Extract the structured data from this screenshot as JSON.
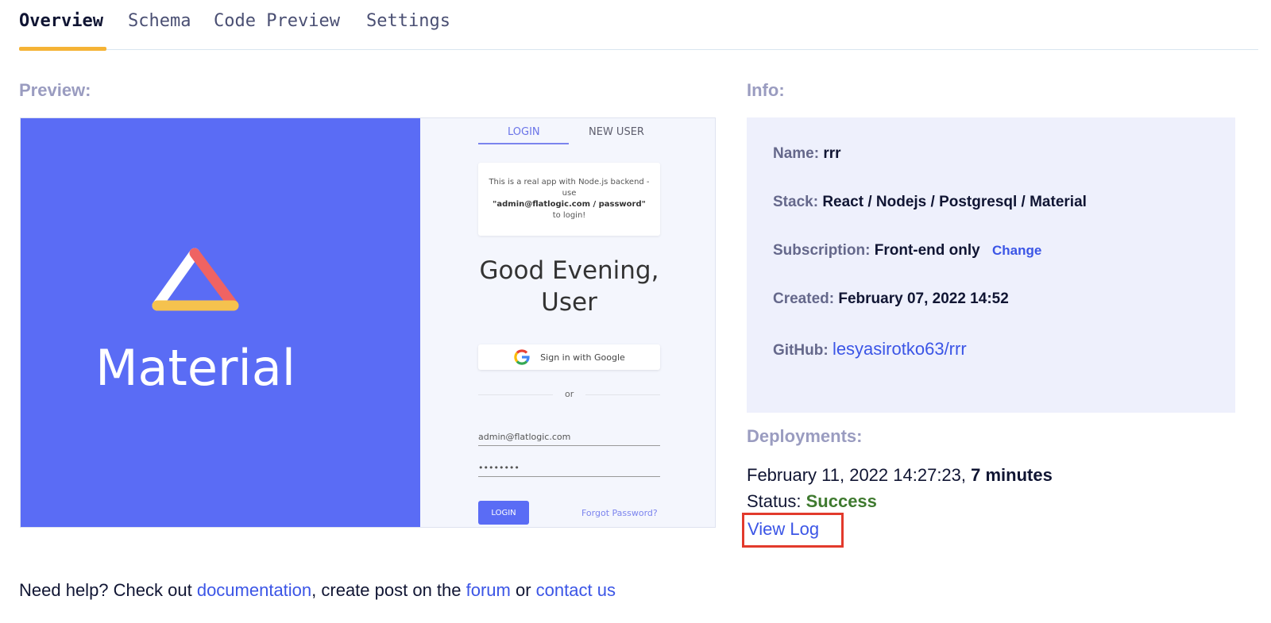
{
  "tabs": [
    "Overview",
    "Schema",
    "Code Preview",
    "Settings"
  ],
  "preview": {
    "title": "Preview:",
    "brand": "Material",
    "login_tab": "LOGIN",
    "new_user_tab": "NEW USER",
    "notice_line1": "This is a real app with Node.js backend -",
    "notice_line2": "use",
    "notice_creds": "\"admin@flatlogic.com / password\"",
    "notice_line3": "to login!",
    "greeting_line1": "Good Evening,",
    "greeting_line2": "User",
    "google_btn": "Sign in with Google",
    "or": "or",
    "email_value": "admin@flatlogic.com",
    "password_value": "••••••••",
    "login_btn": "LOGIN",
    "forgot": "Forgot Password?",
    "colors": {
      "brand_blue": "#5a6cf5"
    }
  },
  "info": {
    "title": "Info:",
    "name_label": "Name:",
    "name_value": "rrr",
    "stack_label": "Stack:",
    "stack_value": "React / Nodejs / Postgresql / Material",
    "subscription_label": "Subscription:",
    "subscription_value": "Front-end only",
    "change_link": "Change",
    "created_label": "Created:",
    "created_value": "February 07, 2022 14:52",
    "github_label": "GitHub:",
    "github_value": "lesyasirotko63/rrr"
  },
  "deployments": {
    "title": "Deployments:",
    "date": "February 11, 2022 14:27:23,",
    "duration": "7 minutes",
    "status_label": "Status:",
    "status_value": "Success",
    "view_log": "View Log"
  },
  "help": {
    "prefix": "Need help? Check out ",
    "documentation": "documentation",
    "middle": ", create post on the ",
    "forum": "forum",
    "or": " or ",
    "contact": "contact us"
  }
}
